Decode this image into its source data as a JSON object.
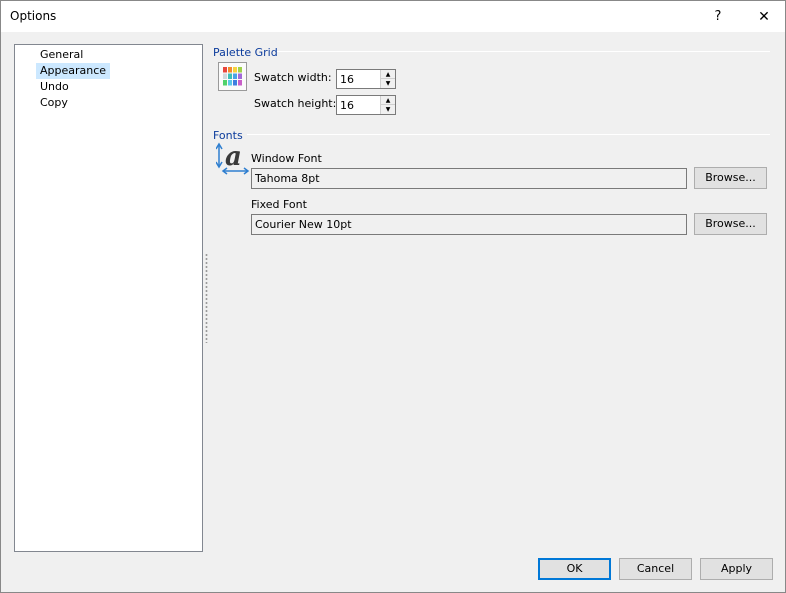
{
  "window": {
    "title": "Options",
    "help_glyph": "?",
    "close_glyph": "✕"
  },
  "nav": {
    "items": [
      "General",
      "Appearance",
      "Undo",
      "Copy"
    ],
    "selected_index": 1
  },
  "palette_grid": {
    "title": "Palette Grid",
    "swatch_width_label": "Swatch width:",
    "swatch_width_value": "16",
    "swatch_height_label": "Swatch height:",
    "swatch_height_value": "16",
    "swatch_colors": [
      "#e8463c",
      "#f28a2e",
      "#f7d23e",
      "#9fd24a",
      "#cfd9dc",
      "#3cc0b6",
      "#4aa3e8",
      "#a26ad8",
      "#4fd26a",
      "#5ac8e8",
      "#3f7fe0",
      "#c85fc8"
    ]
  },
  "fonts": {
    "title": "Fonts",
    "window_font_label": "Window Font",
    "window_font_value": "Tahoma 8pt",
    "fixed_font_label": "Fixed Font",
    "fixed_font_value": "Courier New 10pt",
    "browse_label": "Browse..."
  },
  "footer": {
    "ok_label": "OK",
    "cancel_label": "Cancel",
    "apply_label": "Apply"
  },
  "colors": {
    "accent": "#0078d7",
    "group_title": "#0b3b9c",
    "selection": "#cce8ff"
  }
}
